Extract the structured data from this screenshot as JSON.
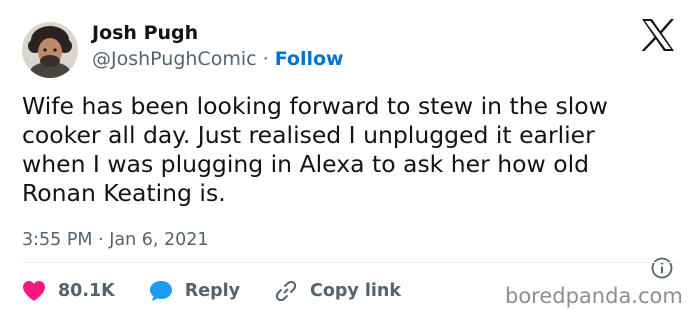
{
  "author": {
    "display_name": "Josh Pugh",
    "handle": "@JoshPughComic",
    "separator": "·",
    "follow_label": "Follow"
  },
  "tweet": {
    "text_lines": [
      "Wife has been looking forward to stew in the slow",
      "cooker all day. Just realised I unplugged it earlier",
      "when I was plugging in Alexa to ask her how old",
      "Ronan Keating is."
    ],
    "timestamp": "3:55 PM · Jan 6, 2021"
  },
  "actions": {
    "likes": "80.1K",
    "reply_label": "Reply",
    "copy_link_label": "Copy link"
  },
  "watermark": "boredpanda.com",
  "icons": {
    "platform": "x-logo-icon",
    "info": "info-icon",
    "like": "heart-icon",
    "reply": "speech-bubble-icon",
    "copy": "link-icon"
  },
  "colors": {
    "text": "#0f1419",
    "secondary": "#536471",
    "link": "#0074d4",
    "like": "#f91880",
    "reply": "#1d9bf0"
  }
}
